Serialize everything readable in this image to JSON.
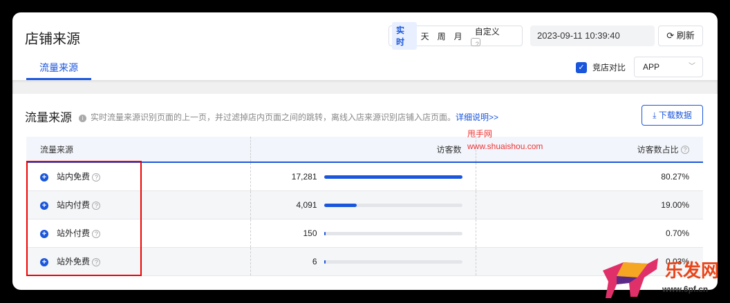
{
  "header": {
    "title": "店铺来源",
    "periods": [
      "实时",
      "天",
      "周",
      "月",
      "自定义"
    ],
    "active_period": "实时",
    "datetime": "2023-09-11 10:39:40",
    "refresh_label": "刷新"
  },
  "tabs": [
    {
      "label": "流量来源",
      "active": true
    }
  ],
  "compare": {
    "label": "竞店对比",
    "checked": true,
    "platform": "APP"
  },
  "section": {
    "title": "流量来源",
    "description": "实时流量来源识别页面的上一页，并过滤掉店内页面之间的跳转，离线入店来源识别店铺入店页面。",
    "link": "详细说明>>",
    "download_label": "下载数据"
  },
  "table": {
    "headers": [
      "流量来源",
      "访客数",
      "访客数占比"
    ],
    "rows": [
      {
        "source": "站内免费",
        "visitors": "17,281",
        "share": "80.27%",
        "bar": 1.0
      },
      {
        "source": "站内付费",
        "visitors": "4,091",
        "share": "19.00%",
        "bar": 0.237
      },
      {
        "source": "站外付费",
        "visitors": "150",
        "share": "0.70%",
        "bar": 0.009
      },
      {
        "source": "站外免费",
        "visitors": "6",
        "share": "0.03%",
        "bar": 0.0003
      }
    ]
  },
  "watermarks": {
    "site_name": "甩手网",
    "site_url": "www.shuaishou.com",
    "logo_text": "乐发网",
    "logo_url": "www.6pf.cn"
  },
  "colors": {
    "accent": "#1a56db",
    "highlight_box": "#e00000"
  }
}
